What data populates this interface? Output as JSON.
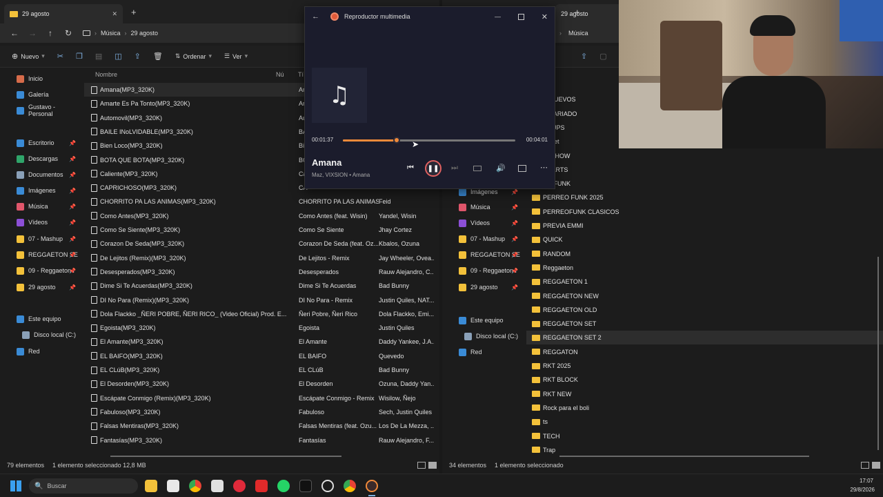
{
  "left": {
    "tab_title": "29 agosto",
    "breadcrumb": [
      "Música",
      "29 agosto"
    ],
    "commands": [
      "Nuevo",
      "Ordenar",
      "Ver"
    ],
    "sidebar": [
      {
        "label": "Inicio",
        "color": "#d66b4a"
      },
      {
        "label": "Galería",
        "color": "#3a8bd6"
      },
      {
        "label": "Gustavo - Personal",
        "color": "#3a8bd6"
      },
      {
        "label": "Escritorio",
        "color": "#3a8bd6",
        "pin": true
      },
      {
        "label": "Descargas",
        "color": "#2fa56a",
        "pin": true
      },
      {
        "label": "Documentos",
        "color": "#8aa0b8",
        "pin": true
      },
      {
        "label": "Imágenes",
        "color": "#3a8bd6",
        "pin": true
      },
      {
        "label": "Música",
        "color": "#e0566b",
        "pin": true
      },
      {
        "label": "Vídeos",
        "color": "#8c4fd6",
        "pin": true
      },
      {
        "label": "07 - Mashup",
        "color": "#f3c13a",
        "pin": true
      },
      {
        "label": "REGGAETON SE",
        "color": "#f3c13a",
        "pin": true
      },
      {
        "label": "09 - Reggaeton I",
        "color": "#f3c13a",
        "pin": true
      },
      {
        "label": "29 agosto",
        "color": "#f3c13a",
        "pin": true
      },
      {
        "label": "Este equipo",
        "color": "#3a8bd6"
      },
      {
        "label": "Disco local (C:)",
        "color": "#8aa0b8"
      },
      {
        "label": "Red",
        "color": "#3a8bd6"
      }
    ],
    "columns": [
      "Nombre",
      "Nú",
      "Tí"
    ],
    "files": [
      {
        "name": "Amana(MP3_320K)",
        "title": "Am",
        "artist": ""
      },
      {
        "name": "Amarte Es Pa Tonto(MP3_320K)",
        "title": "Am",
        "artist": ""
      },
      {
        "name": "Automovil(MP3_320K)",
        "title": "Au",
        "artist": ""
      },
      {
        "name": "BAILE INoLVIDABLE(MP3_320K)",
        "title": "BA",
        "artist": ""
      },
      {
        "name": "Bien Loco(MP3_320K)",
        "title": "Bi",
        "artist": ""
      },
      {
        "name": "BOTA QUE BOTA(MP3_320K)",
        "title": "BO",
        "artist": ""
      },
      {
        "name": "Caliente(MP3_320K)",
        "title": "Ca",
        "artist": ""
      },
      {
        "name": "CAPRICHOSO(MP3_320K)",
        "title": "CA",
        "artist": ""
      },
      {
        "name": "CHORRITO PA LAS ANIMAS(MP3_320K)",
        "title": "CHORRITO PA LAS ANIMAS",
        "artist": "Feid"
      },
      {
        "name": "Como Antes(MP3_320K)",
        "title": "Como Antes (feat. Wisin)",
        "artist": "Yandel, Wisin"
      },
      {
        "name": "Como Se Siente(MP3_320K)",
        "title": "Como Se Siente",
        "artist": "Jhay Cortez"
      },
      {
        "name": "Corazon De Seda(MP3_320K)",
        "title": "Corazon De Seda (feat. Oz...",
        "artist": "Kbalos, Ozuna"
      },
      {
        "name": "De Lejitos (Remix)(MP3_320K)",
        "title": "De Lejitos - Remix",
        "artist": "Jay Wheeler, Ovea..."
      },
      {
        "name": "Desesperados(MP3_320K)",
        "title": "Desesperados",
        "artist": "Rauw Alejandro, C..."
      },
      {
        "name": "Dime Si Te Acuerdas(MP3_320K)",
        "title": "Dime Si Te Acuerdas",
        "artist": "Bad Bunny"
      },
      {
        "name": "DI No Para (Remix)(MP3_320K)",
        "title": "DI No Para - Remix",
        "artist": "Justin Quiles, NAT..."
      },
      {
        "name": "Dola Flackko _ÑERI POBRE, ÑERI RICO_ (Video Oficial) Prod. E...",
        "title": "Ñeri Pobre, Ñeri Rico",
        "artist": "Dola Flackko, Emi..."
      },
      {
        "name": "Egoista(MP3_320K)",
        "title": "Egoista",
        "artist": "Justin Quiles"
      },
      {
        "name": "El Amante(MP3_320K)",
        "title": "El Amante",
        "artist": "Daddy Yankee, J.A..."
      },
      {
        "name": "EL BAIFO(MP3_320K)",
        "title": "EL BAIFO",
        "artist": "Quevedo"
      },
      {
        "name": "EL CLúB(MP3_320K)",
        "title": "EL CLúB",
        "artist": "Bad Bunny"
      },
      {
        "name": "El Desorden(MP3_320K)",
        "title": "El Desorden",
        "artist": "Ozuna, Daddy Yan..."
      },
      {
        "name": "Escápate Conmigo (Remix)(MP3_320K)",
        "title": "Escápate Conmigo - Remix",
        "artist": "Wisilow, Ñejo"
      },
      {
        "name": "Fabuloso(MP3_320K)",
        "title": "Fabuloso",
        "artist": "Sech, Justin Quiles"
      },
      {
        "name": "Falsas Mentiras(MP3_320K)",
        "title": "Falsas Mentiras (feat. Ozu...",
        "artist": "Los De La Mezza, ..."
      },
      {
        "name": "Fantasías(MP3_320K)",
        "title": "Fantasías",
        "artist": "Rauw Alejandro, F..."
      }
    ],
    "status": [
      "79 elementos",
      "1 elemento seleccionado 12,8 MB"
    ]
  },
  "right": {
    "tab_title": "29 agosto",
    "breadcrumb": [
      "Música"
    ],
    "sidebar": [
      {
        "label": "Imágenes",
        "color": "#3a8bd6",
        "pin": true
      },
      {
        "label": "Música",
        "color": "#e0566b",
        "pin": true
      },
      {
        "label": "Vídeos",
        "color": "#8c4fd6",
        "pin": true
      },
      {
        "label": "07 - Mashup",
        "color": "#f3c13a",
        "pin": true
      },
      {
        "label": "REGGAETON SE",
        "color": "#f3c13a",
        "pin": true
      },
      {
        "label": "09 - Reggaeton I",
        "color": "#f3c13a",
        "pin": true
      },
      {
        "label": "29 agosto",
        "color": "#f3c13a",
        "pin": true
      },
      {
        "label": "Este equipo",
        "color": "#3a8bd6"
      },
      {
        "label": "Disco local (C:)",
        "color": "#8aa0b8"
      },
      {
        "label": "Red",
        "color": "#3a8bd6"
      }
    ],
    "folders": [
      "",
      "O NUEVOS",
      "O VARIADO",
      "CHUPS",
      "eli set",
      "IN SHOW",
      "SHARTS",
      "EO FUNK",
      "PERREO FUNK 2025",
      "PERREOFUNK CLASICOS",
      "PREVIA EMMI",
      "QUICK",
      "RANDOM",
      "Reggaeton",
      "REGGAETON 1",
      "REGGAETON NEW",
      "REGGAETON OLD",
      "REGGAETON SET",
      "REGGAETON SET 2",
      "REGGATON",
      "RKT 2025",
      "RKT BLOCK",
      "RKT NEW",
      "Rock para el boli",
      "ts",
      "TECH",
      "Trap"
    ],
    "status": [
      "34 elementos",
      "1 elemento seleccionado"
    ]
  },
  "player": {
    "title": "Reproductor multimedia",
    "track": "Amana",
    "subtitle": "Maz, VIXSION • Amana",
    "elapsed": "00:01:37",
    "total": "00:04:01",
    "progress": 0.31
  },
  "taskbar": {
    "search_placeholder": "Buscar",
    "time": "17:07",
    "date": "29/8/2026"
  }
}
